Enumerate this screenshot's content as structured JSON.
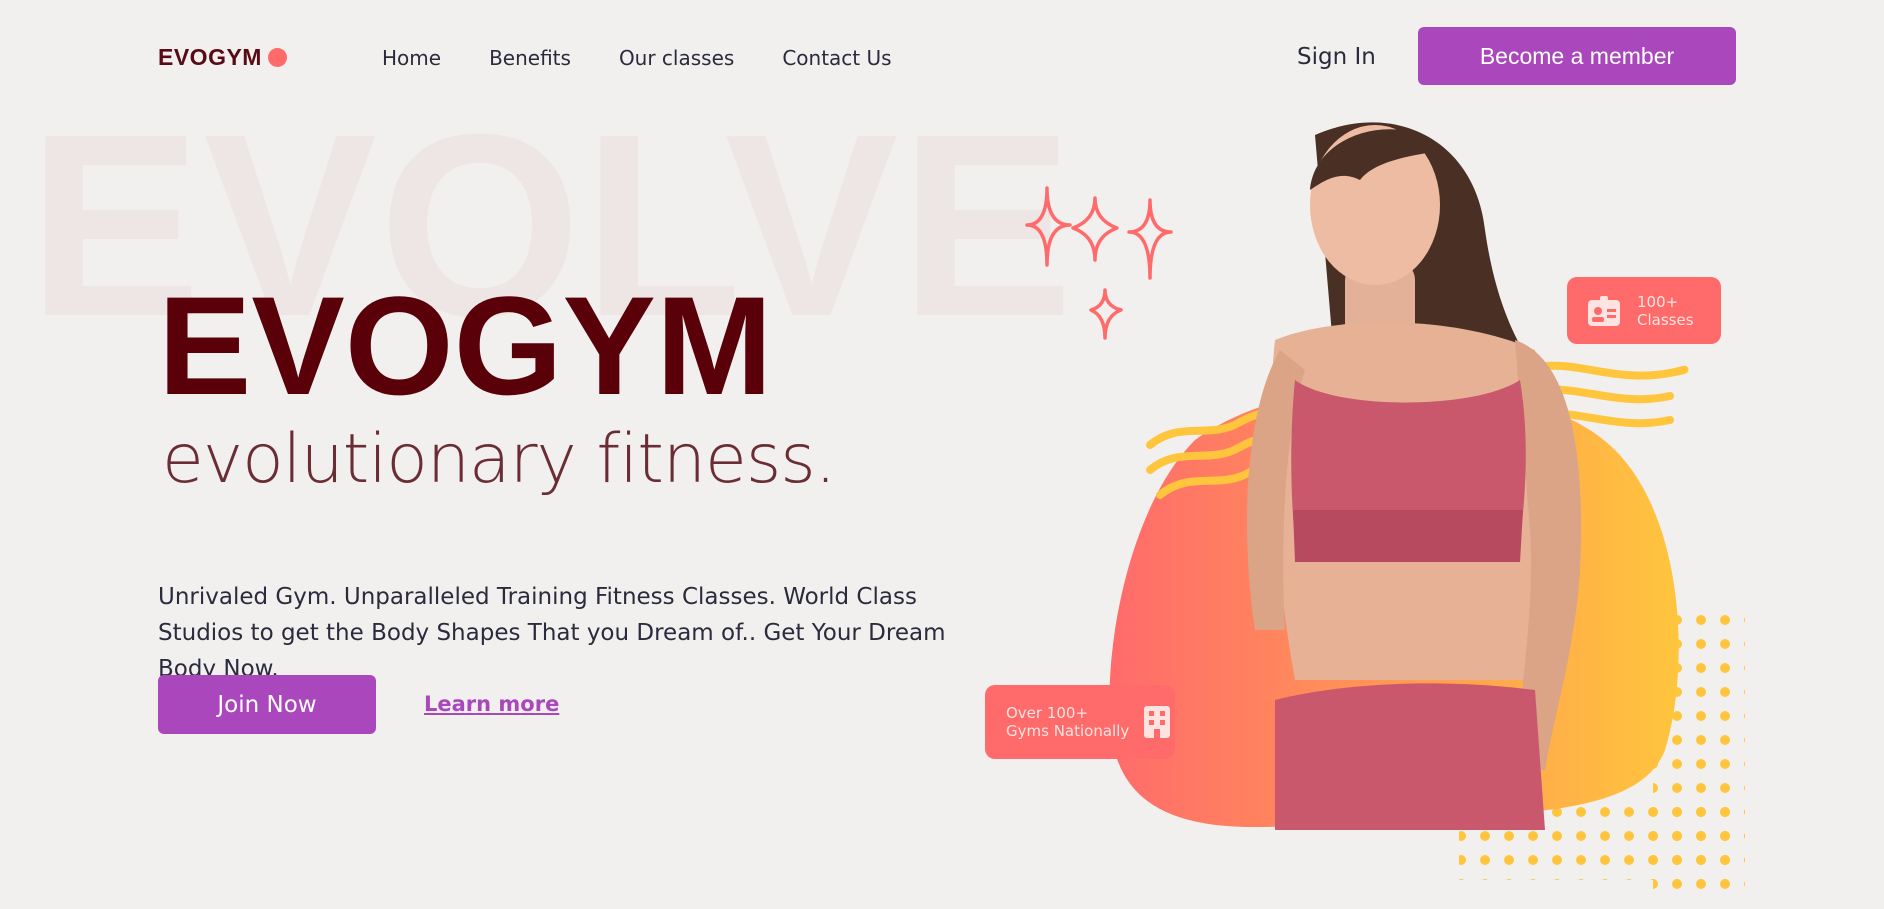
{
  "brand": {
    "name": "EVOGYM",
    "accent": "#ab47bc",
    "logo_dot_color": "#ff6b6b"
  },
  "nav": {
    "items": [
      {
        "label": "Home"
      },
      {
        "label": "Benefits"
      },
      {
        "label": "Our classes"
      },
      {
        "label": "Contact Us"
      }
    ],
    "signin_label": "Sign In",
    "cta_label": "Become a member"
  },
  "hero": {
    "background_word": "EVOLVE",
    "title": "EVOGYM",
    "tagline": "evolutionary fitness.",
    "description": "Unrivaled Gym. Unparalleled Training Fitness Classes. World Class Studios to get the Body Shapes That you Dream of.. Get Your Dream Body Now.",
    "join_label": "Join Now",
    "learn_label": "Learn more"
  },
  "badges": {
    "classes": {
      "line1": "100+",
      "line2": "Classes",
      "icon": "id-card-icon"
    },
    "gyms": {
      "line1": "Over 100+",
      "line2": "Gyms Nationally",
      "icon": "building-icon"
    }
  }
}
